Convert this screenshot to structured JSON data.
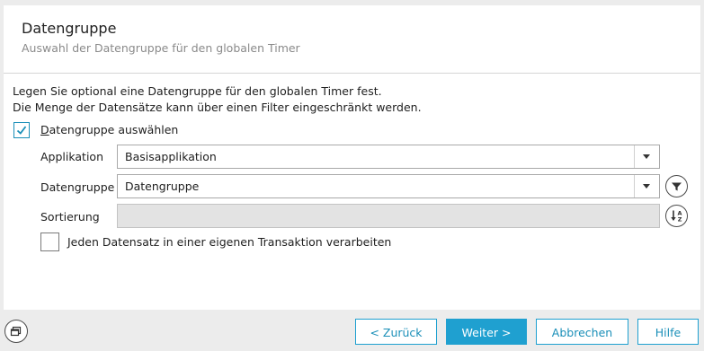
{
  "header": {
    "title": "Datengruppe",
    "subtitle": "Auswahl der Datengruppe für den globalen Timer"
  },
  "description": {
    "line1": "Legen Sie optional eine Datengruppe für den globalen Timer fest.",
    "line2": "Die Menge der Datensätze kann über einen Filter eingeschränkt werden."
  },
  "select_datagroup": {
    "label_underlined": "D",
    "label_rest": "atengruppe auswählen",
    "checked": true
  },
  "fields": {
    "application": {
      "label": "Applikation",
      "value": "Basisapplikation"
    },
    "datagroup": {
      "label": "Datengruppe",
      "value": "Datengruppe"
    },
    "sorting": {
      "label": "Sortierung",
      "value": ""
    }
  },
  "transaction": {
    "label": "Jeden Datensatz in einer eigenen Transaktion verarbeiten",
    "checked": false
  },
  "icons": {
    "filter": "filter-icon",
    "sort": "sort-az-icon",
    "dropdown": "chevron-down-icon",
    "corner": "window-icon"
  },
  "footer": {
    "back": "< Zurück",
    "next": "Weiter >",
    "cancel": "Abbrechen",
    "help": "Hilfe"
  },
  "colors": {
    "accent": "#1fa0d0",
    "background": "#ececec",
    "disabled_field": "#e3e3e3"
  }
}
